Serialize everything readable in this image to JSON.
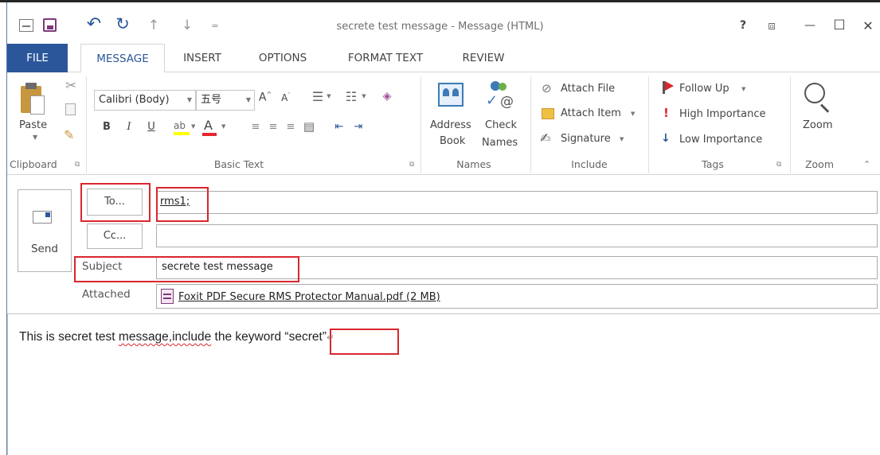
{
  "window": {
    "title": "secrete test message - Message (HTML)",
    "help": "?",
    "restore_ribbon": "⧈",
    "minimize": "—",
    "maximize": "☐",
    "close": "✕"
  },
  "qat": {
    "undo": "↶",
    "redo": "↻",
    "up": "↑",
    "down": "↓",
    "customize": "="
  },
  "tabs": [
    {
      "label": "FILE"
    },
    {
      "label": "MESSAGE"
    },
    {
      "label": "INSERT"
    },
    {
      "label": "OPTIONS"
    },
    {
      "label": "FORMAT TEXT"
    },
    {
      "label": "REVIEW"
    }
  ],
  "ribbon": {
    "clipboard": {
      "paste": "Paste",
      "group": "Clipboard"
    },
    "basic_text": {
      "font": "Calibri (Body)",
      "size": "五号",
      "bold": "B",
      "italic": "I",
      "underline": "U",
      "group": "Basic Text"
    },
    "names": {
      "address_book_1": "Address",
      "address_book_2": "Book",
      "check_names_1": "Check",
      "check_names_2": "Names",
      "group": "Names"
    },
    "include": {
      "attach_file": "Attach File",
      "attach_item": "Attach Item",
      "signature": "Signature",
      "group": "Include"
    },
    "tags": {
      "follow_up": "Follow Up",
      "high_importance": "High Importance",
      "low_importance": "Low Importance",
      "group": "Tags"
    },
    "zoom": {
      "label": "Zoom",
      "group": "Zoom"
    }
  },
  "compose": {
    "send": "Send",
    "to_button": "To...",
    "to_value": "rms1;",
    "cc_button": "Cc...",
    "cc_value": "",
    "subject_label": "Subject",
    "subject_value": "secrete test message",
    "attached_label": "Attached",
    "attachment": "Foxit PDF Secure RMS Protector Manual.pdf (2 MB)"
  },
  "body": {
    "text_a": "This is secret test ",
    "text_b": "message,include",
    "text_c": " the keyword ",
    "keyword": "“secret”",
    "para_mark": "↵"
  },
  "colors": {
    "accent": "#2b579a",
    "highlight_box": "#d9272e"
  }
}
